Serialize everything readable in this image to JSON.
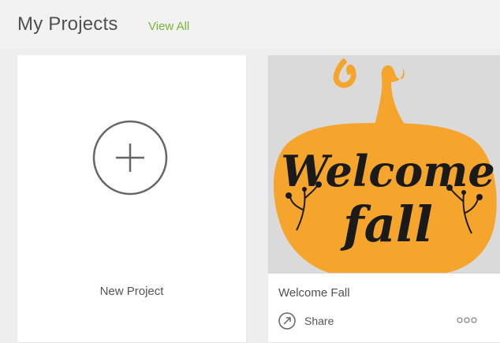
{
  "header": {
    "title": "My Projects",
    "view_all_label": "View All"
  },
  "new_project": {
    "label": "New Project",
    "icon": "plus-circle-icon"
  },
  "projects": [
    {
      "title": "Welcome Fall",
      "thumbnail_text": [
        "Welcome",
        "fall"
      ],
      "share_label": "Share",
      "share_icon": "share-icon",
      "more_icon": "more-options-icon"
    }
  ],
  "colors": {
    "accent_link": "#7ab538",
    "pumpkin": "#f5a52b",
    "lettering": "#1a1a1a",
    "thumb_bg": "#dadada"
  }
}
